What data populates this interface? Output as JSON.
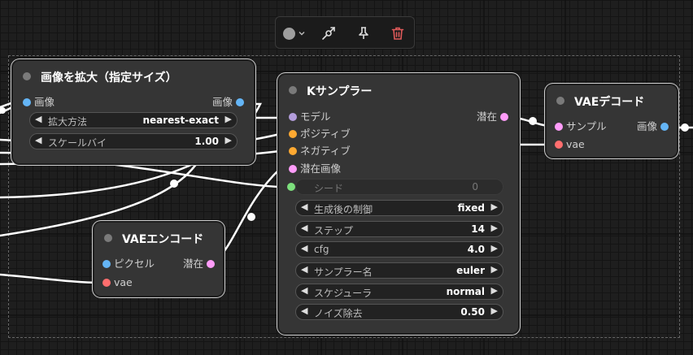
{
  "colors": {
    "model": "#b39ddb",
    "conditioning": "#ffa931",
    "latent": "#ff9cf9",
    "image": "#64b5f6",
    "vae": "#ff6e6e",
    "int": "#7de07d",
    "delete": "#e05a5a"
  },
  "toolbar": {
    "icons": [
      "color-circle-icon",
      "chevron-down-icon",
      "bypass-icon",
      "pin-icon",
      "trash-icon"
    ]
  },
  "nodes": {
    "upscale": {
      "title": "画像を拡大（指定サイズ）",
      "input": "画像",
      "output": "画像",
      "widgets": [
        {
          "label": "拡大方法",
          "value": "nearest-exact"
        },
        {
          "label": "スケールバイ",
          "value": "1.00"
        }
      ]
    },
    "ksampler": {
      "title": "Kサンプラー",
      "inputs": [
        "モデル",
        "ポジティブ",
        "ネガティブ",
        "潜在画像"
      ],
      "output": "潜在",
      "seed": {
        "label": "シード",
        "value": "0"
      },
      "widgets": [
        {
          "label": "生成後の制御",
          "value": "fixed"
        },
        {
          "label": "ステップ",
          "value": "14"
        },
        {
          "label": "cfg",
          "value": "4.0"
        },
        {
          "label": "サンプラー名",
          "value": "euler"
        },
        {
          "label": "スケジューラ",
          "value": "normal"
        },
        {
          "label": "ノイズ除去",
          "value": "0.50"
        }
      ]
    },
    "vae_encode": {
      "title": "VAEエンコード",
      "inputs": [
        "ピクセル",
        "vae"
      ],
      "output": "潜在"
    },
    "vae_decode": {
      "title": "VAEデコード",
      "inputs": [
        "サンプル",
        "vae"
      ],
      "output": "画像"
    }
  }
}
